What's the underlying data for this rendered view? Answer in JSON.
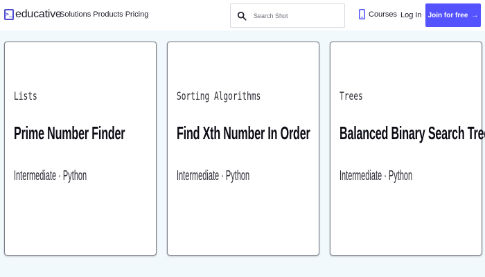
{
  "header": {
    "logo_text": "educative",
    "logo_icon": "terminal-logo-icon",
    "nav": [
      "Solutions",
      "Products",
      "Pricing"
    ],
    "search_placeholder": "Search Shot",
    "courses_label": "Courses",
    "login_label": "Log In",
    "join_label": "Join for free",
    "join_arrow": "→",
    "accent": "#5553ff"
  },
  "cards": [
    {
      "topic": "Lists",
      "title": "Prime Number Finder",
      "meta": "Intermediate · Python"
    },
    {
      "topic": "Sorting Algorithms",
      "title": "Find Xth Number In Order",
      "meta": "Intermediate · Python"
    },
    {
      "topic": "Trees",
      "title": "Balanced Binary Search Tree",
      "meta": "Intermediate · Python"
    }
  ]
}
